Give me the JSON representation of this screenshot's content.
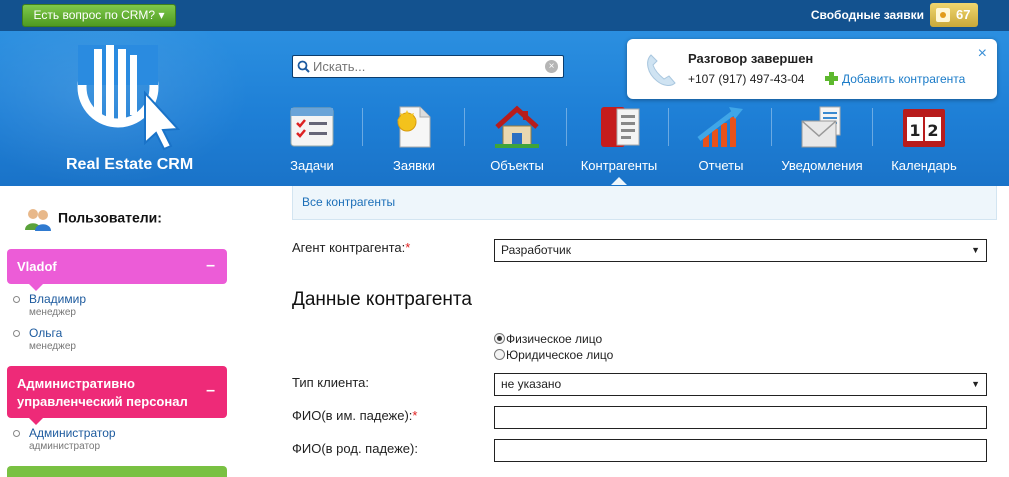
{
  "topbar": {
    "ask_label": "Есть вопрос по CRM?",
    "ask_caret": "▾",
    "free_label": "Свободные заявки",
    "free_count": "67"
  },
  "brand": {
    "name": "Real Estate CRM"
  },
  "search": {
    "placeholder": "Искать...",
    "clear_icon": "×"
  },
  "nav": {
    "items": [
      {
        "label": "Задачи",
        "icon": "tasks-icon"
      },
      {
        "label": "Заявки",
        "icon": "requests-icon"
      },
      {
        "label": "Объекты",
        "icon": "house-icon"
      },
      {
        "label": "Контрагенты",
        "icon": "contacts-book-icon"
      },
      {
        "label": "Отчеты",
        "icon": "chart-growth-icon"
      },
      {
        "label": "Уведомления",
        "icon": "envelope-icon"
      },
      {
        "label": "Календарь",
        "icon": "calendar-icon"
      }
    ],
    "active": "Контрагенты"
  },
  "popup": {
    "title": "Разговор завершен",
    "phone": "+107 (917) 497-43-04",
    "add_contact": "Добавить контрагента",
    "close": "×"
  },
  "sidebar": {
    "title": "Пользователи:",
    "groups": [
      {
        "name": "Vladof",
        "toggle": "–",
        "color": "#ec5cd7",
        "members": [
          {
            "name": "Владимир",
            "role": "менеджер"
          },
          {
            "name": "Ольга",
            "role": "менеджер"
          }
        ]
      },
      {
        "name_line1": "Административно",
        "name_line2": "управленческий персонал",
        "toggle": "–",
        "color": "#ee2a78",
        "members": [
          {
            "name": "Администратор",
            "role": "администратор"
          }
        ]
      },
      {
        "color": "#79c142"
      }
    ]
  },
  "main": {
    "breadcrumb": "Все контрагенты",
    "agent_label": "Агент контрагента:",
    "required_mark": "*",
    "agent_value": "Разработчик",
    "section_title": "Данные контрагента",
    "person_types": [
      {
        "label": "Физическое лицо",
        "checked": true
      },
      {
        "label": "Юридическое лицо",
        "checked": false
      }
    ],
    "client_type_label": "Тип клиента:",
    "client_type_value": "не указано",
    "fio_nom_label": "ФИО(в им. падеже):",
    "fio_nom_value": "",
    "fio_gen_label": "ФИО(в род. падеже):",
    "fio_gen_value": "",
    "select_arrow": "▼"
  }
}
